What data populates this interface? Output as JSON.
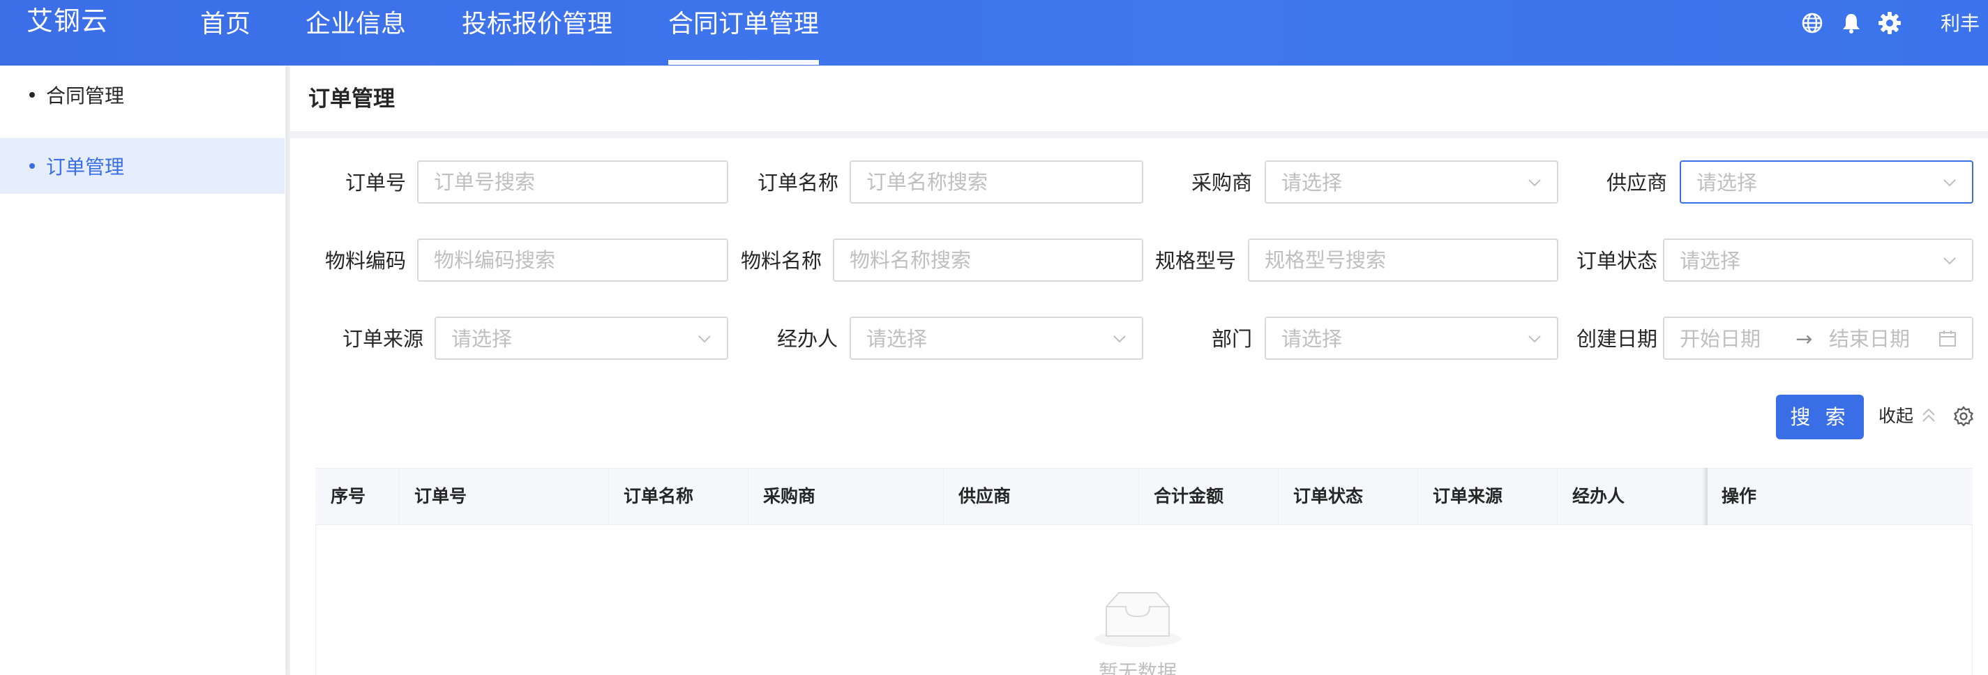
{
  "header": {
    "logo": "艾钢云",
    "nav": [
      "首页",
      "企业信息",
      "投标报价管理",
      "合同订单管理"
    ],
    "active_nav": "合同订单管理",
    "icons": [
      "globe-icon",
      "bell-icon",
      "gear-icon"
    ],
    "user": "利丰"
  },
  "sidebar": {
    "items": [
      {
        "label": "合同管理",
        "active": false
      },
      {
        "label": "订单管理",
        "active": true
      }
    ]
  },
  "page": {
    "title": "订单管理"
  },
  "filters": {
    "order_no": {
      "label": "订单号",
      "placeholder": "订单号搜索"
    },
    "order_name": {
      "label": "订单名称",
      "placeholder": "订单名称搜索"
    },
    "purchaser": {
      "label": "采购商",
      "placeholder": "请选择"
    },
    "supplier": {
      "label": "供应商",
      "placeholder": "请选择"
    },
    "material_code": {
      "label": "物料编码",
      "placeholder": "物料编码搜索"
    },
    "material_name": {
      "label": "物料名称",
      "placeholder": "物料名称搜索"
    },
    "spec": {
      "label": "规格型号",
      "placeholder": "规格型号搜索"
    },
    "order_status": {
      "label": "订单状态",
      "placeholder": "请选择"
    },
    "order_source": {
      "label": "订单来源",
      "placeholder": "请选择"
    },
    "handler": {
      "label": "经办人",
      "placeholder": "请选择"
    },
    "department": {
      "label": "部门",
      "placeholder": "请选择"
    },
    "created_date": {
      "label": "创建日期",
      "start_placeholder": "开始日期",
      "end_placeholder": "结束日期",
      "separator": "→"
    }
  },
  "actions": {
    "search": "搜 索",
    "collapse": "收起"
  },
  "table": {
    "columns": [
      "序号",
      "订单号",
      "订单名称",
      "采购商",
      "供应商",
      "合计金额",
      "订单状态",
      "订单来源",
      "经办人",
      "操作"
    ],
    "rows": [],
    "empty_text": "暂无数据"
  },
  "colors": {
    "primary": "#3a6ee6",
    "header_bg": "#3d72ec",
    "placeholder": "#bfbfbf"
  }
}
